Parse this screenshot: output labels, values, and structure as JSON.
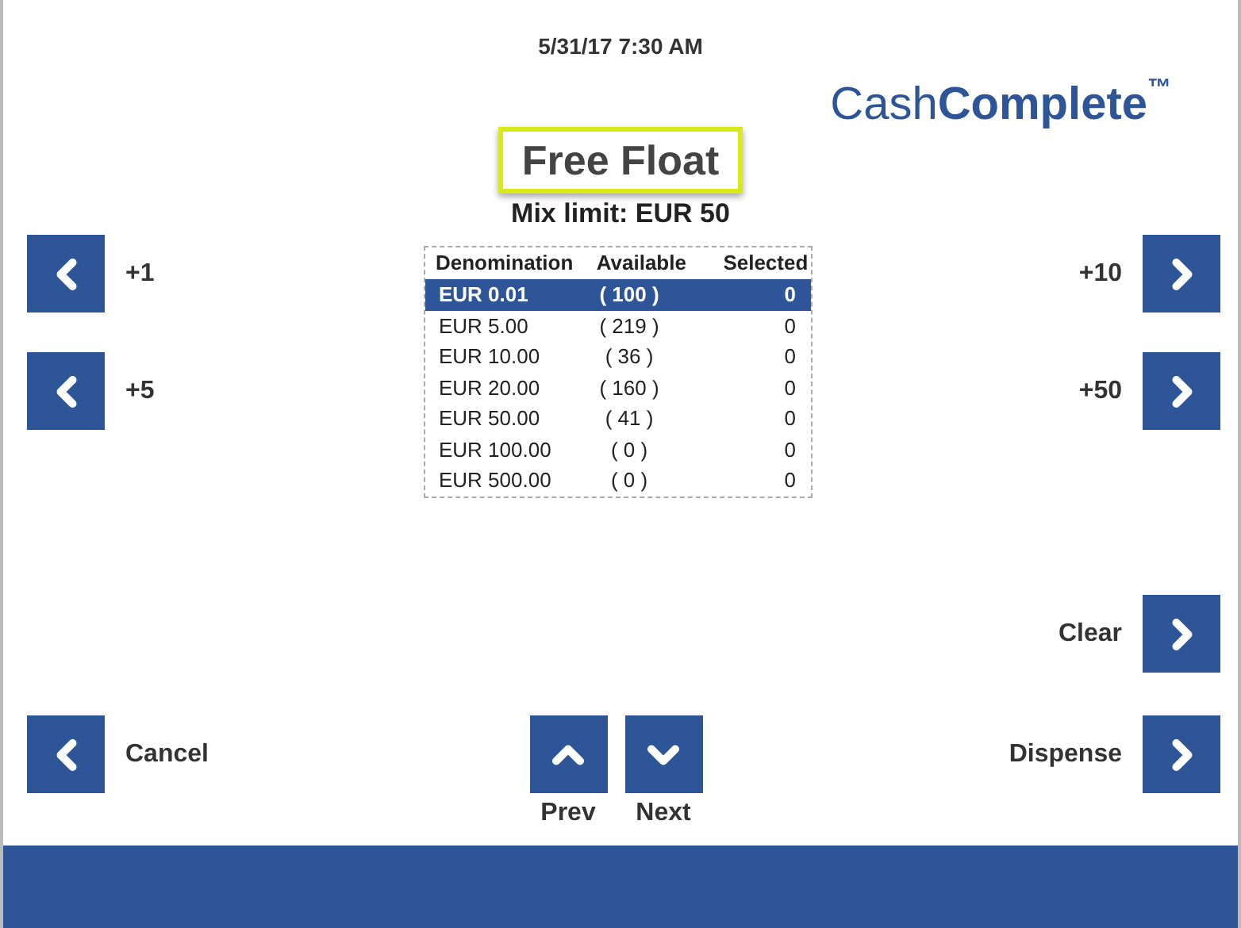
{
  "datetime": "5/31/17 7:30 AM",
  "logo": {
    "light": "Cash",
    "bold": "Complete",
    "mark": "™"
  },
  "title": "Free Float",
  "subtitle": "Mix limit: EUR 50",
  "table": {
    "columns": [
      "Denomination",
      "Available",
      "Selected"
    ],
    "rows": [
      {
        "cells": [
          "EUR 0.01",
          "( 100 )",
          "0"
        ],
        "selected": true
      },
      {
        "cells": [
          "EUR 5.00",
          "( 219 )",
          "0"
        ],
        "selected": false
      },
      {
        "cells": [
          "EUR 10.00",
          "( 36 )",
          "0"
        ],
        "selected": false
      },
      {
        "cells": [
          "EUR 20.00",
          "( 160 )",
          "0"
        ],
        "selected": false
      },
      {
        "cells": [
          "EUR 50.00",
          "( 41 )",
          "0"
        ],
        "selected": false
      },
      {
        "cells": [
          "EUR 100.00",
          "( 0 )",
          "0"
        ],
        "selected": false
      },
      {
        "cells": [
          "EUR 500.00",
          "( 0 )",
          "0"
        ],
        "selected": false
      }
    ]
  },
  "left_buttons": [
    {
      "label": "+1"
    },
    {
      "label": "+5"
    },
    {
      "label": "Cancel"
    }
  ],
  "right_buttons": [
    {
      "label": "+10"
    },
    {
      "label": "+50"
    },
    {
      "label": "Clear"
    },
    {
      "label": "Dispense"
    }
  ],
  "nav_buttons": [
    {
      "kind": "up",
      "label": "Prev"
    },
    {
      "kind": "down",
      "label": "Next"
    }
  ]
}
